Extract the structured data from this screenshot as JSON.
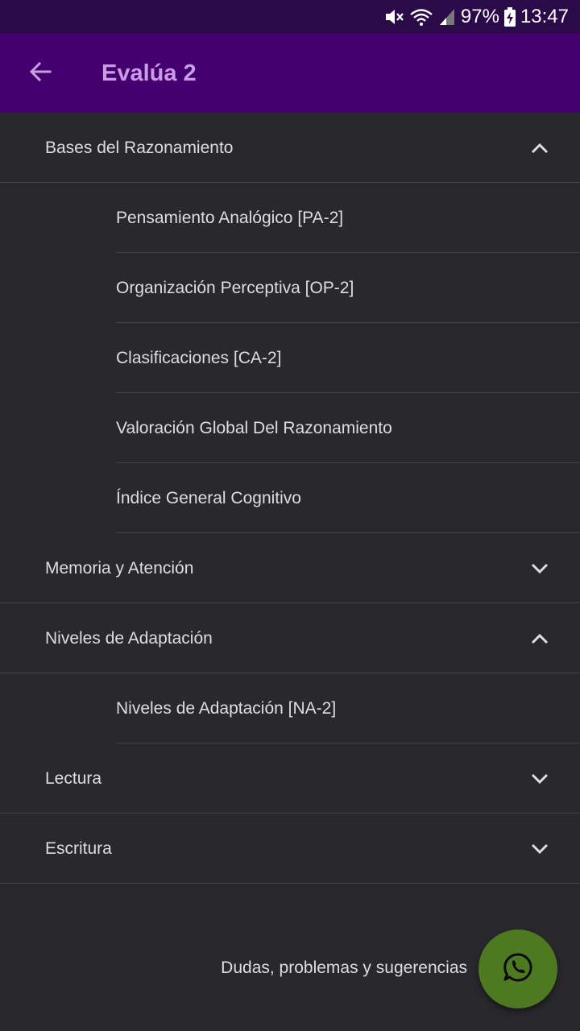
{
  "status_bar": {
    "battery": "97%",
    "time": "13:47"
  },
  "app_bar": {
    "title": "Evalúa 2",
    "back_icon": "arrow-back-icon"
  },
  "list": {
    "group1": {
      "label": "Bases del Razonamiento",
      "expanded": true,
      "items": [
        "Pensamiento Analógico [PA-2]",
        "Organización Perceptiva [OP-2]",
        "Clasificaciones [CA-2]",
        "Valoración Global Del Razonamiento",
        "Índice General Cognitivo"
      ]
    },
    "group2": {
      "label": "Memoria y Atención",
      "expanded": false
    },
    "group3": {
      "label": "Niveles de Adaptación",
      "expanded": true,
      "items": [
        "Niveles de Adaptación [NA-2]"
      ]
    },
    "group4": {
      "label": "Lectura",
      "expanded": false
    },
    "group5": {
      "label": "Escritura",
      "expanded": false
    }
  },
  "footer": {
    "help_text": "Dudas, problemas y sugerencias",
    "fab_icon": "whatsapp-icon"
  },
  "colors": {
    "status_bar": "#2b0a4a",
    "app_bar": "#45006f",
    "title": "#c79de6",
    "background": "#29282d",
    "fab": "#4d7a20"
  }
}
